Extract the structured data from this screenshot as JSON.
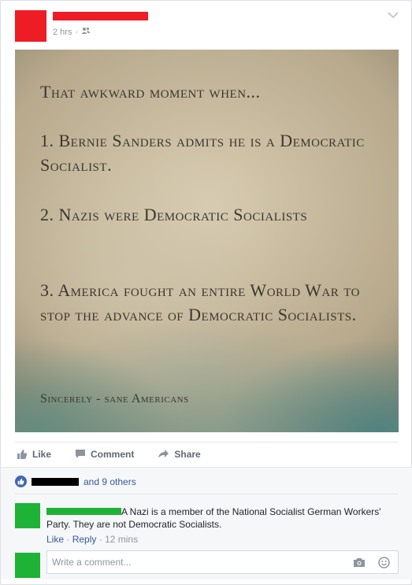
{
  "post": {
    "time": "2 hrs",
    "separator": "·",
    "audience_icon": "friends-icon",
    "redaction_color": "#ee1c25"
  },
  "image": {
    "title": "That awkward moment when...",
    "line1": "1. Bernie Sanders admits he is a Democratic Socialist.",
    "line2": "2. Nazis were Democratic Socialists",
    "line3": "3. America fought an entire World War to stop the advance of Democratic Socialists.",
    "signature": "Sincerely - sane Americans"
  },
  "actions": {
    "like": "Like",
    "comment": "Comment",
    "share": "Share"
  },
  "reactions": {
    "others_text": "and 9 others"
  },
  "comment": {
    "text": "A Nazi is a member of the National Socialist German Workers' Party. They are not Democratic Socialists.",
    "like": "Like",
    "reply": "Reply",
    "sep": "·",
    "time": "12 mins",
    "redaction_color": "#1eb336"
  },
  "write_comment": {
    "placeholder": "Write a comment..."
  }
}
